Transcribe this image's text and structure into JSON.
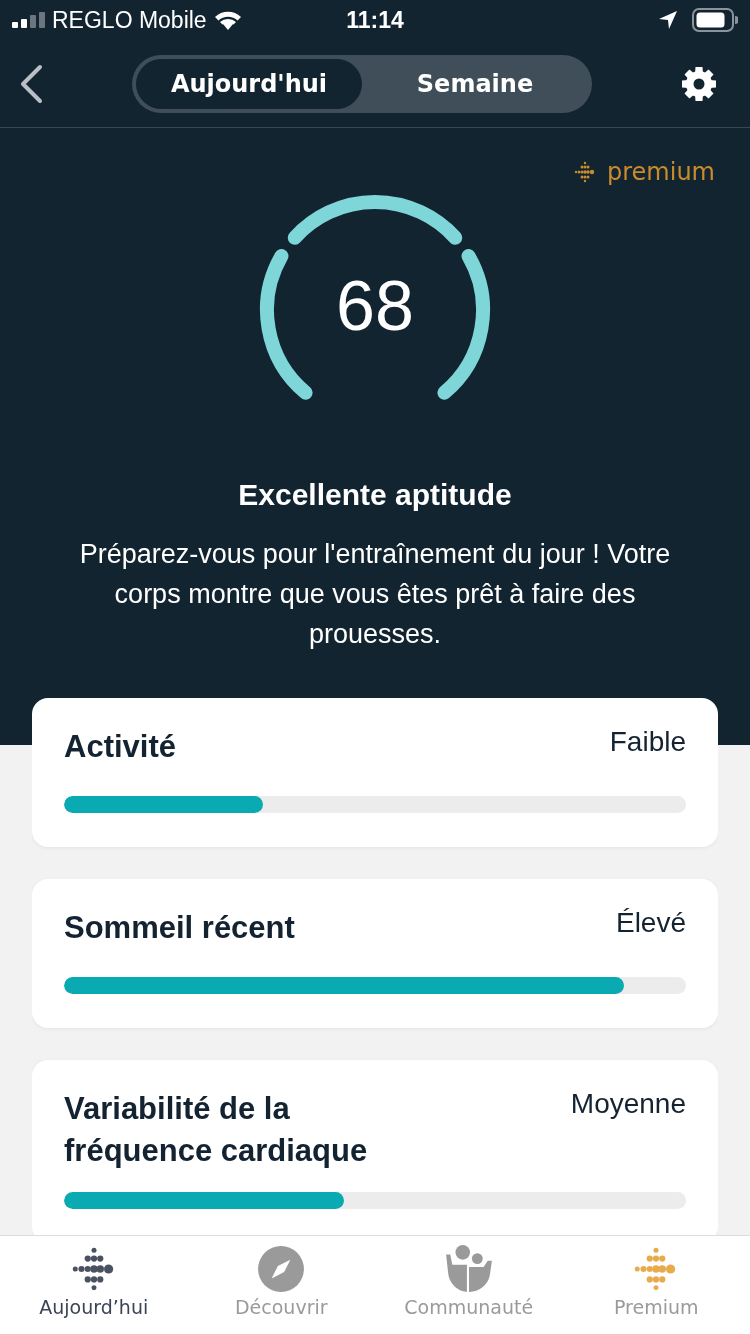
{
  "status_bar": {
    "carrier": "REGLO Mobile",
    "time": "11:14"
  },
  "segments": [
    {
      "label": "Aujourd'hui",
      "selected": true
    },
    {
      "label": "Semaine",
      "selected": false
    }
  ],
  "badge": {
    "label": "premium"
  },
  "score": {
    "value": "68"
  },
  "headline": "Excellente aptitude",
  "message": "Préparez-vous pour l'entraînement du jour ! Votre corps montre que vous êtes prêt à faire des prouesses.",
  "metrics": [
    {
      "title": "Activité",
      "rating": "Faible",
      "level": 0.32
    },
    {
      "title": "Sommeil récent",
      "rating": "Élevé",
      "level": 0.9
    },
    {
      "title": "Variabilité de la fréquence cardiaque",
      "rating": "Moyenne",
      "level": 0.45
    }
  ],
  "tab_bar": [
    {
      "label": "Aujourd’hui",
      "kind": "today",
      "selected": true
    },
    {
      "label": "Découvrir",
      "kind": "discover",
      "selected": false
    },
    {
      "label": "Communauté",
      "kind": "community",
      "selected": false
    },
    {
      "label": "Premium",
      "kind": "premium",
      "selected": false
    }
  ]
}
